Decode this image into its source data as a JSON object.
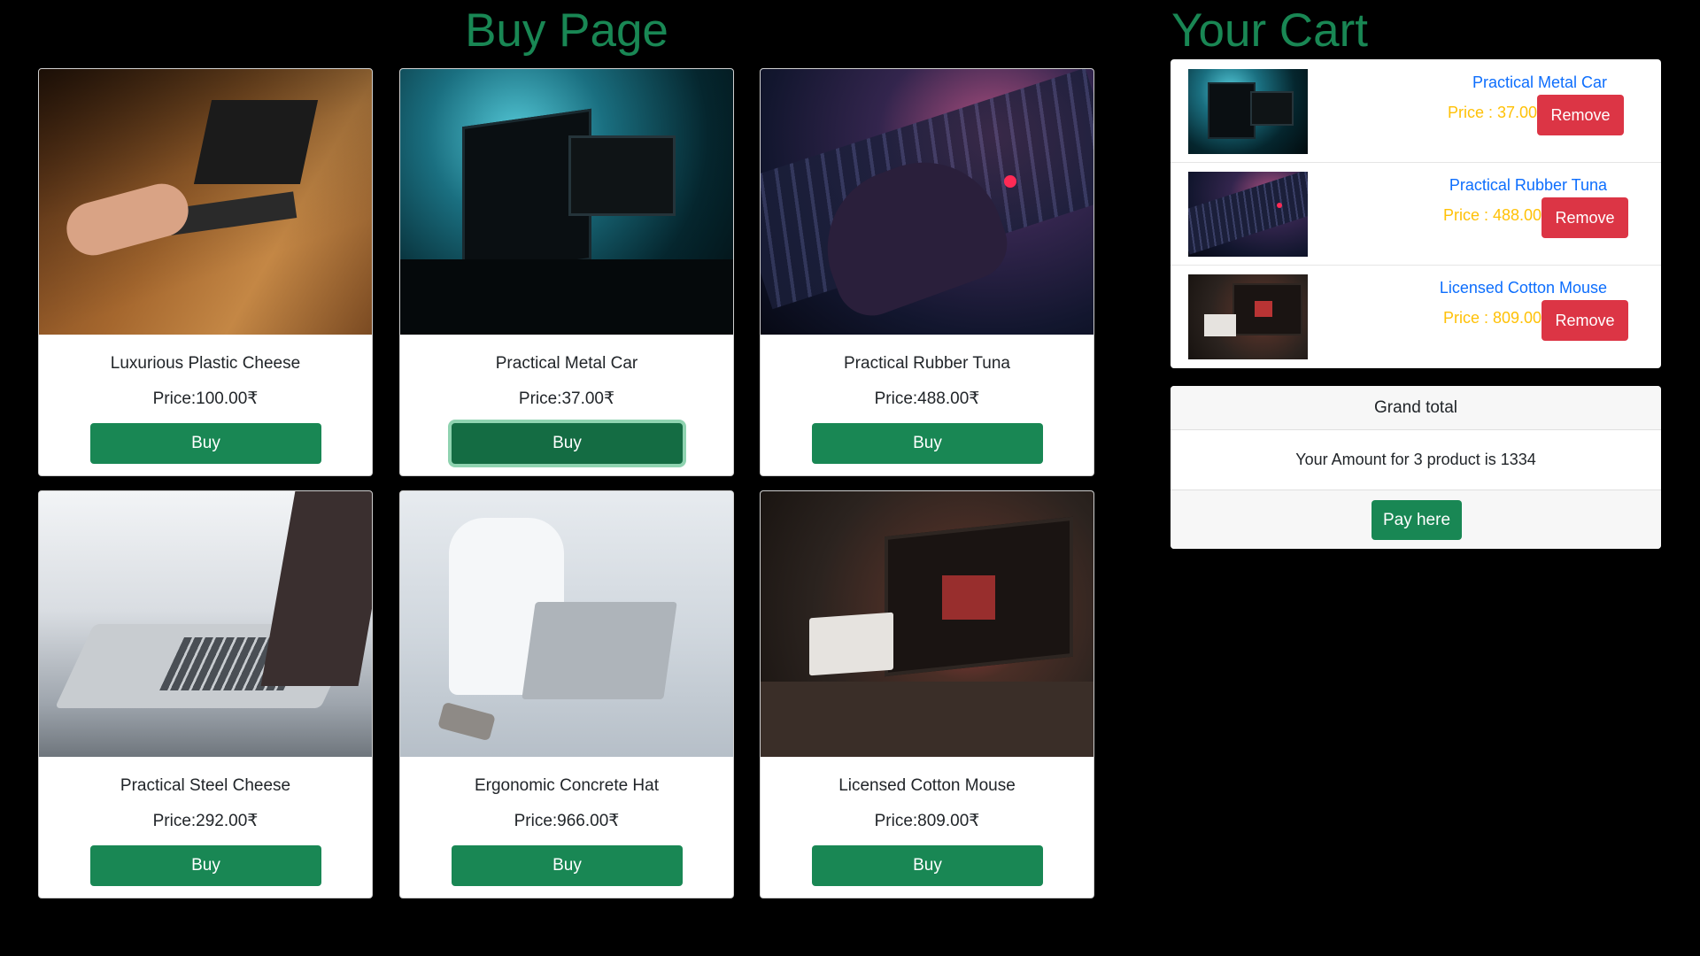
{
  "buy_page": {
    "title": "Buy Page",
    "products": [
      {
        "name": "Luxurious Plastic Cheese",
        "price": "Price:100.00₹",
        "button": "Buy"
      },
      {
        "name": "Practical Metal Car",
        "price": "Price:37.00₹",
        "button": "Buy"
      },
      {
        "name": "Practical Rubber Tuna",
        "price": "Price:488.00₹",
        "button": "Buy"
      },
      {
        "name": "Practical Steel Cheese",
        "price": "Price:292.00₹",
        "button": "Buy"
      },
      {
        "name": "Ergonomic Concrete Hat",
        "price": "Price:966.00₹",
        "button": "Buy"
      },
      {
        "name": "Licensed Cotton Mouse",
        "price": "Price:809.00₹",
        "button": "Buy"
      }
    ]
  },
  "cart": {
    "title": "Your Cart",
    "items": [
      {
        "name": "Practical Metal Car",
        "price": "Price : 37.00",
        "button": "Remove"
      },
      {
        "name": "Practical Rubber Tuna",
        "price": "Price : 488.00",
        "button": "Remove"
      },
      {
        "name": "Licensed Cotton Mouse",
        "price": "Price : 809.00",
        "button": "Remove"
      }
    ],
    "grand_total": {
      "header": "Grand total",
      "text": "Your Amount for 3 product is 1334",
      "button": "Pay here"
    }
  },
  "colors": {
    "heading": "#198754",
    "buy_button": "#198754",
    "remove_button": "#dc3545",
    "cart_item_name": "#0d6efd",
    "cart_item_price": "#ffc107"
  }
}
